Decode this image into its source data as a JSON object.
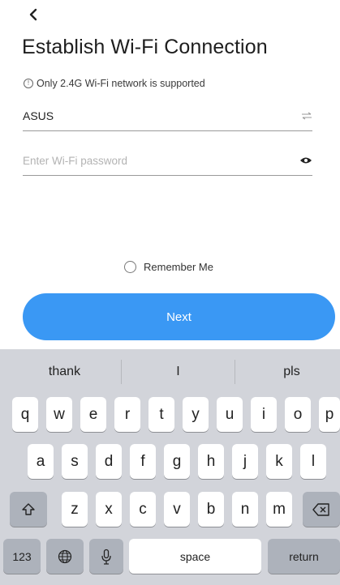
{
  "header": {
    "back_icon": "chevron-left-icon",
    "title": "Establish Wi-Fi Connection"
  },
  "notice": {
    "icon": "info-icon",
    "text": "Only 2.4G Wi-Fi network is supported"
  },
  "ssid_field": {
    "value": "ASUS",
    "icon": "swap-icon"
  },
  "password_field": {
    "value": "",
    "placeholder": "Enter Wi-Fi password",
    "icon": "eye-icon"
  },
  "remember": {
    "label": "Remember Me",
    "checked": false
  },
  "next_button": {
    "label": "Next",
    "color": "#3a98f4"
  },
  "keyboard": {
    "suggestions": [
      "thank",
      "I",
      "pls"
    ],
    "row1": [
      "q",
      "w",
      "e",
      "r",
      "t",
      "y",
      "u",
      "i",
      "o",
      "p"
    ],
    "row2": [
      "a",
      "s",
      "d",
      "f",
      "g",
      "h",
      "j",
      "k",
      "l"
    ],
    "row3": [
      "z",
      "x",
      "c",
      "v",
      "b",
      "n",
      "m"
    ],
    "shift_icon": "shift-icon",
    "delete_icon": "backspace-icon",
    "numbers_label": "123",
    "globe_icon": "globe-icon",
    "mic_icon": "microphone-icon",
    "space_label": "space",
    "return_label": "return"
  }
}
